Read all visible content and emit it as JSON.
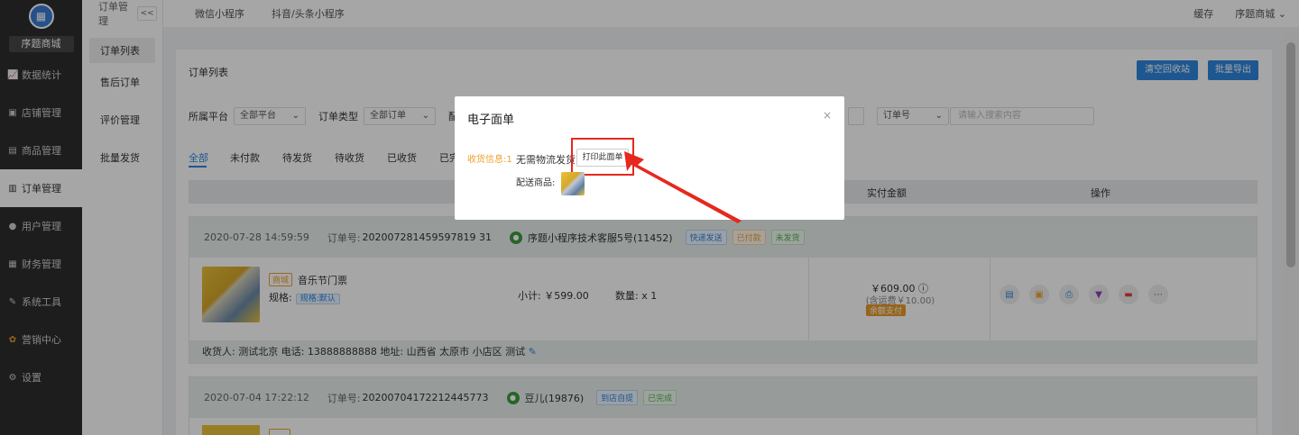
{
  "logo": {
    "text": "序题商城",
    "icon": "store-icon"
  },
  "sidebar": {
    "items": [
      {
        "label": "数据统计",
        "icon": "chart-icon"
      },
      {
        "label": "店铺管理",
        "icon": "store-icon"
      },
      {
        "label": "商品管理",
        "icon": "goods-icon"
      },
      {
        "label": "订单管理",
        "icon": "order-icon"
      },
      {
        "label": "用户管理",
        "icon": "user-icon"
      },
      {
        "label": "财务管理",
        "icon": "finance-icon"
      },
      {
        "label": "系统工具",
        "icon": "wrench-icon"
      },
      {
        "label": "营销中心",
        "icon": "marketing-icon"
      },
      {
        "label": "设置",
        "icon": "gear-icon"
      }
    ],
    "active": 3
  },
  "subsidebar": {
    "title": "订单管理",
    "collapse": "<<",
    "items": [
      "订单列表",
      "售后订单",
      "评价管理",
      "批量发货"
    ]
  },
  "topbar": {
    "tabs": [
      "微信小程序",
      "抖音/头条小程序"
    ],
    "cache": "缓存",
    "store": "序题商城"
  },
  "main": {
    "title": "订单列表",
    "btn_clear": "清空回收站",
    "btn_export": "批量导出",
    "filters": {
      "platform_label": "所属平台",
      "platform_value": "全部平台",
      "type_label": "订单类型",
      "type_value": "全部订单",
      "date_label_partial": "配",
      "search_type": "订单号",
      "search_placeholder": "请输入搜索内容"
    },
    "tabs": [
      "全部",
      "未付款",
      "待发货",
      "待收货",
      "已收货",
      "已完"
    ],
    "table_headers": {
      "amount": "实付金额",
      "ops": "操作"
    }
  },
  "orders": [
    {
      "time": "2020-07-28 14:59:59",
      "id_label": "订单号:",
      "id": "2020072814595978 1931",
      "id_display": "202007281459597819 31",
      "customer": "序题小程序技术客服5号(11452)",
      "tags": [
        "快递发送",
        "已付款",
        "未发货"
      ],
      "shop_tag": "商城",
      "product": "音乐节门票",
      "spec_label": "规格:",
      "spec_value": "规格:默认",
      "subtotal": "小计: ￥599.00",
      "qty": "数量: x 1",
      "price": "￥609.00",
      "price_sub": "(含运费￥10.00)",
      "pay": "余额支付",
      "address": "收货人: 测试北京 电话: 13888888888 地址: 山西省 太原市 小店区 测试"
    },
    {
      "time": "2020-07-04 17:22:12",
      "id_label": "订单号:",
      "id_display": "20200704172212445773",
      "customer": "豆儿(19876)",
      "tags": [
        "到店自提",
        "已完成"
      ]
    }
  ],
  "modal": {
    "title": "电子面单",
    "close": "×",
    "recv_label": "收货信息:1",
    "no_logistics": "无需物流发货",
    "print_btn": "打印此面单",
    "ship_label": "配送商品:"
  },
  "colors": {
    "accent": "#2e86de",
    "sidebar_bg": "#2d2d2d",
    "annotation_red": "#e6281e",
    "warning": "#f0a030",
    "success": "#52b152"
  }
}
